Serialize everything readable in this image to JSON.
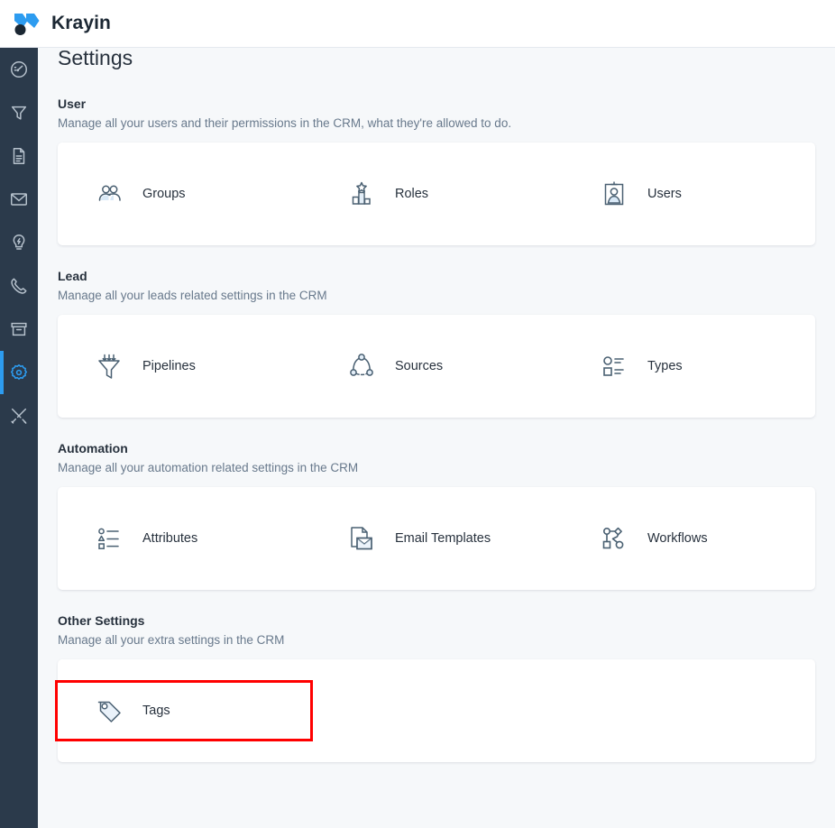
{
  "app": {
    "brand": "Krayin",
    "logo_icon": "krayin-diamond-logo",
    "accent_color": "#2d9cf0",
    "sidebar_color": "#2b3a4b",
    "background_color": "#f6f8fa"
  },
  "sidebar": {
    "items": [
      {
        "name": "dashboard",
        "icon": "speedometer-icon",
        "active": false
      },
      {
        "name": "leads",
        "icon": "funnel-icon",
        "active": false
      },
      {
        "name": "quotes",
        "icon": "document-icon",
        "active": false
      },
      {
        "name": "mail",
        "icon": "envelope-icon",
        "active": false
      },
      {
        "name": "activities",
        "icon": "lightbulb-icon",
        "active": false
      },
      {
        "name": "contacts",
        "icon": "phone-icon",
        "active": false
      },
      {
        "name": "products",
        "icon": "archive-box-icon",
        "active": false
      },
      {
        "name": "settings",
        "icon": "gear-icon",
        "active": true
      },
      {
        "name": "configuration",
        "icon": "tools-icon",
        "active": false
      }
    ]
  },
  "page": {
    "title": "Settings"
  },
  "sections": [
    {
      "title": "User",
      "description": "Manage all your users and their permissions in the CRM, what they're allowed to do.",
      "tiles": [
        {
          "label": "Groups",
          "icon": "people-group-icon",
          "highlighted": false
        },
        {
          "label": "Roles",
          "icon": "podium-star-icon",
          "highlighted": false
        },
        {
          "label": "Users",
          "icon": "id-badge-icon",
          "highlighted": false
        }
      ]
    },
    {
      "title": "Lead",
      "description": "Manage all your leads related settings in the CRM",
      "tiles": [
        {
          "label": "Pipelines",
          "icon": "funnel-arrows-icon",
          "highlighted": false
        },
        {
          "label": "Sources",
          "icon": "share-nodes-icon",
          "highlighted": false
        },
        {
          "label": "Types",
          "icon": "shapes-list-icon",
          "highlighted": false
        }
      ]
    },
    {
      "title": "Automation",
      "description": "Manage all your automation related settings in the CRM",
      "tiles": [
        {
          "label": "Attributes",
          "icon": "attribute-list-icon",
          "highlighted": false
        },
        {
          "label": "Email Templates",
          "icon": "document-envelope-icon",
          "highlighted": false
        },
        {
          "label": "Workflows",
          "icon": "workflow-nodes-icon",
          "highlighted": false
        }
      ]
    },
    {
      "title": "Other Settings",
      "description": "Manage all your extra settings in the CRM",
      "tiles": [
        {
          "label": "Tags",
          "icon": "tag-icon",
          "highlighted": true
        }
      ]
    }
  ],
  "annotation": {
    "highlight_color": "#ff0000",
    "target": "Tags"
  }
}
